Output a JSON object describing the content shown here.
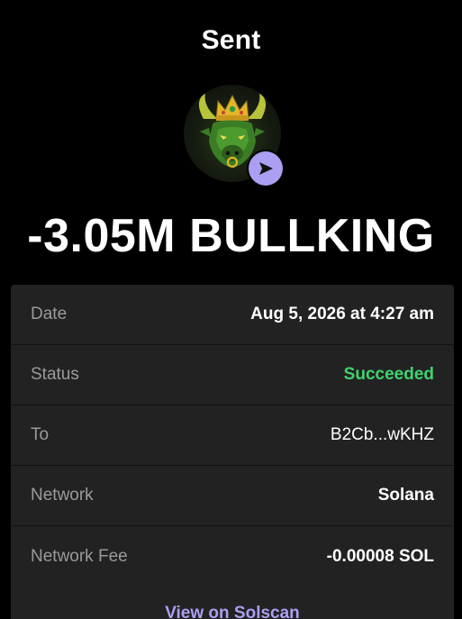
{
  "header": {
    "title": "Sent"
  },
  "token": {
    "name": "BULLKING",
    "avatar_icon": "bull-king-token-icon",
    "badge_icon": "send-arrow-icon",
    "badge_color": "#ab9ff2"
  },
  "amount": {
    "text": "-3.05M BULLKING"
  },
  "details": {
    "rows": [
      {
        "label": "Date",
        "value": "Aug 5, 2026 at 4:27 am"
      },
      {
        "label": "Status",
        "value": "Succeeded"
      },
      {
        "label": "To",
        "value": "B2Cb...wKHZ"
      },
      {
        "label": "Network",
        "value": "Solana"
      },
      {
        "label": "Network Fee",
        "value": "-0.00008 SOL"
      }
    ],
    "explorer_link": "View on Solscan"
  },
  "colors": {
    "background": "#000000",
    "card": "#222222",
    "success": "#3ed36f",
    "accent": "#ab9ff2",
    "muted_text": "#9a9a9a"
  }
}
